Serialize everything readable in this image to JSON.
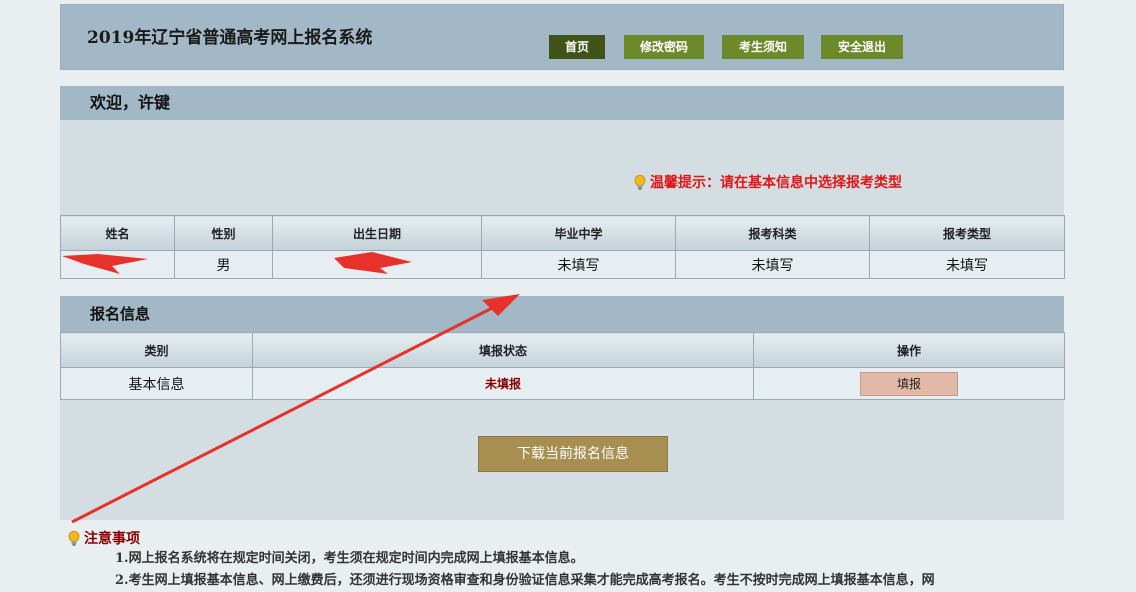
{
  "header": {
    "title": "2019年辽宁省普通高考网上报名系统",
    "nav": [
      {
        "label": "首页"
      },
      {
        "label": "修改密码"
      },
      {
        "label": "考生须知"
      },
      {
        "label": "安全退出"
      }
    ]
  },
  "welcome": {
    "greeting": "欢迎，许键",
    "tip": "温馨提示：请在基本信息中选择报考类型",
    "columns": [
      "姓名",
      "性别",
      "出生日期",
      "毕业中学",
      "报考科类",
      "报考类型"
    ],
    "row": {
      "name": "",
      "gender": "男",
      "birth": "",
      "school": "未填写",
      "subject": "未填写",
      "type": "未填写"
    }
  },
  "registration": {
    "title": "报名信息",
    "columns": [
      "类别",
      "填报状态",
      "操作"
    ],
    "row": {
      "category": "基本信息",
      "status": "未填报",
      "action": "填报"
    },
    "download_label": "下载当前报名信息"
  },
  "notes": {
    "title": "注意事项",
    "items": [
      "1.网上报名系统将在规定时间关闭，考生须在规定时间内完成网上填报基本信息。",
      "2.考生网上填报基本信息、网上缴费后，还须进行现场资格审查和身份验证信息采集才能完成高考报名。考生不按时完成网上填报基本信息，网"
    ]
  },
  "colors": {
    "header_bg": "#a3b8c6",
    "nav_active": "#3f5416",
    "nav_normal": "#6c8a2a",
    "tip_red": "#e21616",
    "download_bg": "#a68f51",
    "annotation_red": "#e8312a"
  }
}
